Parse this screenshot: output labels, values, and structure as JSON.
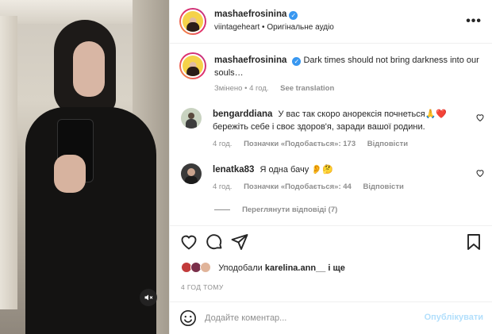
{
  "post": {
    "author": "mashaefrosinina",
    "audio_author": "viintageheart",
    "audio_label": "Оригінальне аудіо",
    "more_label": "•••",
    "caption_text": "Dark times should not bring darkness into our souls…",
    "caption_meta_edited": "Змінено",
    "caption_meta_time": "4 год.",
    "see_translation": "See translation"
  },
  "comments": [
    {
      "user": "bengarddiana",
      "text": "У вас так скоро анорексія почнеться🙏❤️ бережіть себе і своє здоров'я, заради вашої родини.",
      "time": "4 год.",
      "likes_label": "Позначки «Подобається»: 173",
      "reply_label": "Відповісти"
    },
    {
      "user": "lenatka83",
      "text": "Я одна бачу 👂🤔",
      "time": "4 год.",
      "likes_label": "Позначки «Подобається»: 44",
      "reply_label": "Відповісти"
    }
  ],
  "view_replies": "Переглянути відповіді (7)",
  "likes": {
    "prefix": "Уподобали",
    "user": "karelina.ann__",
    "suffix": "і ще"
  },
  "time_ago": "4 ГОД ТОМУ",
  "composer": {
    "placeholder": "Додайте коментар...",
    "post_label": "Опублікувати"
  },
  "colors": {
    "link_blue": "#00376b",
    "verified_blue": "#3897f0",
    "post_disabled": "#b2dffc",
    "like_red": "#ed4956"
  }
}
